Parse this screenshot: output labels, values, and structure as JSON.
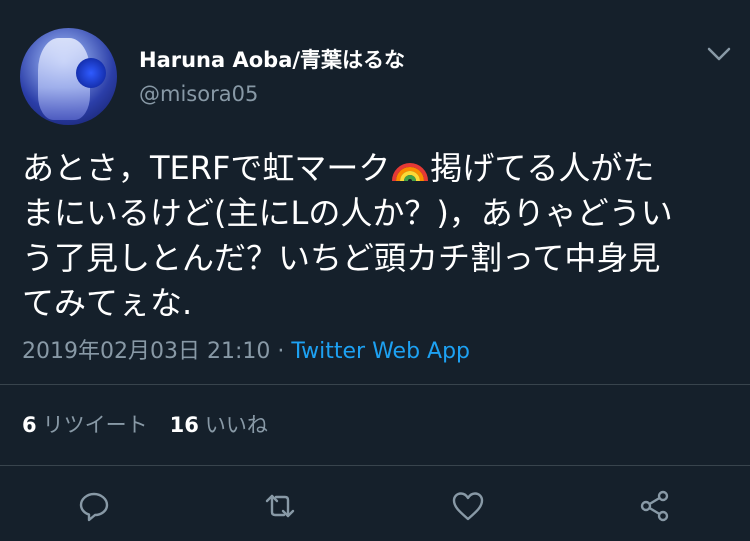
{
  "tweet": {
    "display_name": "Haruna Aoba/青葉はるな",
    "handle": "@misora05",
    "text_line1_before": "あとさ，TERFで虹マーク",
    "text_line1_after": "掲げてる人がた",
    "text_line2": "まにいるけど(主にLの人か？)，ありゃどうい",
    "text_line3": "う了見しとんだ？いちど頭カチ割って中身見",
    "text_line4": "てみてぇな.",
    "emoji": "rainbow",
    "timestamp": "2019年02月03日 21:10",
    "separator": " · ",
    "source": "Twitter Web App",
    "retweets": {
      "count": "6",
      "label": "リツイート"
    },
    "likes": {
      "count": "16",
      "label": "いいね"
    }
  },
  "icons": {
    "menu": "chevron-down-icon",
    "reply": "reply-icon",
    "retweet": "retweet-icon",
    "like": "heart-icon",
    "share": "share-icon"
  },
  "colors": {
    "background": "#15202b",
    "text": "#ffffff",
    "secondary": "#8899a6",
    "link": "#1da1f2",
    "divider": "#38444d"
  }
}
